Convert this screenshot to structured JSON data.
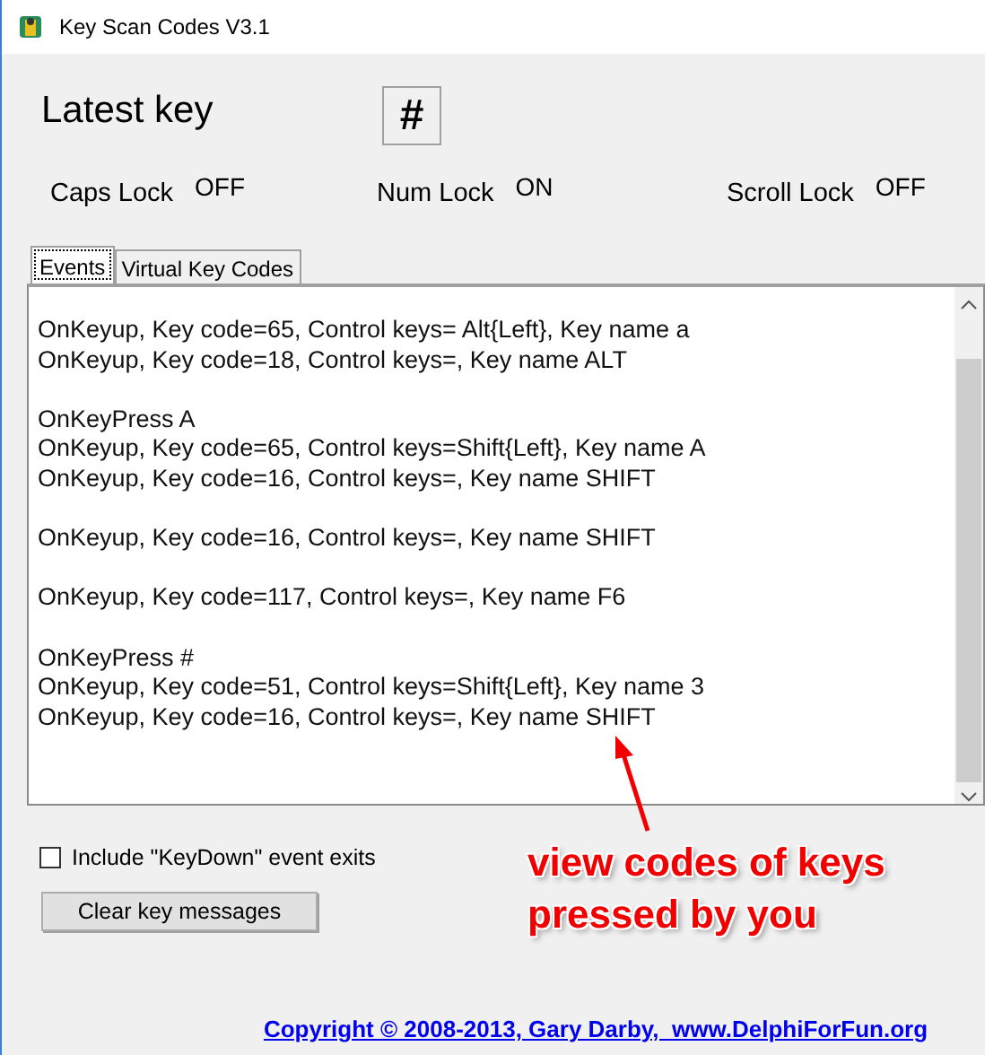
{
  "window": {
    "title": "Key Scan Codes V3.1"
  },
  "latest_key": {
    "label": "Latest key",
    "value": "#"
  },
  "locks": [
    {
      "label": "Caps Lock",
      "state": "OFF"
    },
    {
      "label": "Num Lock",
      "state": "ON"
    },
    {
      "label": "Scroll Lock",
      "state": "OFF"
    }
  ],
  "tabs": [
    {
      "label": "Events",
      "selected": true
    },
    {
      "label": "Virtual Key Codes",
      "selected": false
    }
  ],
  "events": [
    [
      "OnKeyup, Key code=65, Control keys= Alt{Left}, Key name a",
      "OnKeyup, Key code=18, Control keys=, Key name ALT"
    ],
    [
      "OnKeyPress A",
      "OnKeyup, Key code=65, Control keys=Shift{Left}, Key name A",
      "OnKeyup, Key code=16, Control keys=, Key name SHIFT"
    ],
    [
      "OnKeyup, Key code=16, Control keys=, Key name SHIFT"
    ],
    [
      "OnKeyup, Key code=117, Control keys=, Key name F6"
    ],
    [
      "OnKeyPress #",
      "OnKeyup, Key code=51, Control keys=Shift{Left}, Key name 3",
      "OnKeyup, Key code=16, Control keys=, Key name SHIFT"
    ]
  ],
  "include_keydown": {
    "label": "Include \"KeyDown\" event exits",
    "checked": false
  },
  "clear_button": "Clear key messages",
  "annotation": "view codes of keys pressed by you",
  "footer_link": "Copyright © 2008-2013, Gary Darby,  www.DelphiForFun.org"
}
